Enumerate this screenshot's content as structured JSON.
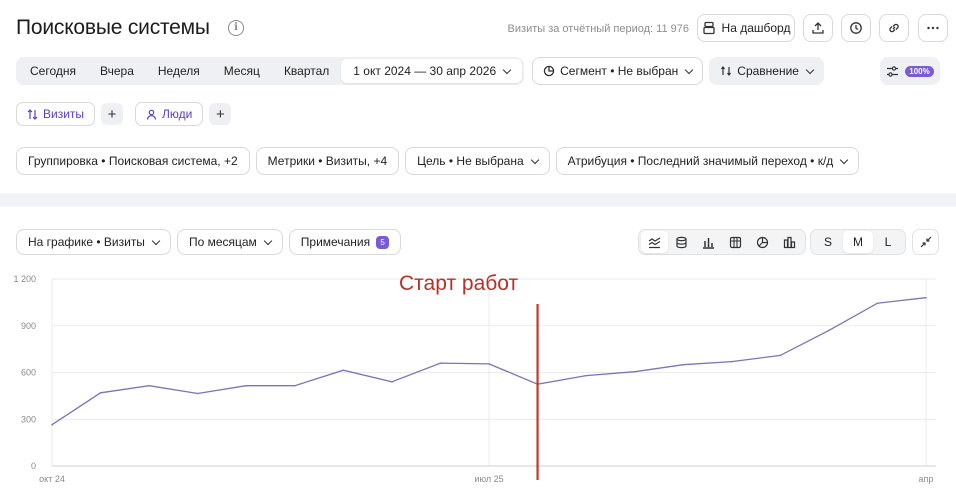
{
  "header": {
    "title": "Поисковые системы",
    "visits_total": "Визиты за отчётный период: 11 976",
    "dashboard_label": "На дашборд",
    "icons": [
      "info-icon",
      "dashboard-icon",
      "upload-icon",
      "clock-icon",
      "link-icon",
      "more-icon"
    ]
  },
  "periods": {
    "items": [
      "Сегодня",
      "Вчера",
      "Неделя",
      "Месяц",
      "Квартал"
    ],
    "range": "1 окт 2024 — 30 апр 2026"
  },
  "segment_label": "Сегмент • Не выбран",
  "compare_label": "Сравнение",
  "sampling_badge": "100%",
  "metric_chips": {
    "visits": "Визиты",
    "people": "Люди"
  },
  "options": {
    "grouping": "Группировка • Поисковая система, +2",
    "metrics": "Метрики • Визиты, +4",
    "goal": "Цель • Не выбрана",
    "attribution": "Атрибуция • Последний значимый переход • к/д"
  },
  "chart_toolbar": {
    "on_chart": "На графике • Визиты",
    "by_months": "По месяцам",
    "notes": "Примечания",
    "notes_count": "5",
    "sizes": [
      "S",
      "M",
      "L"
    ],
    "active_size": "M"
  },
  "annotation": {
    "text": "Старт работ",
    "color": "#b8302a"
  },
  "colors": {
    "series": "#7b74b5",
    "accent": "#7a5ad8",
    "annotation_line": "#c0392b"
  },
  "chart_data": {
    "type": "line",
    "y_ticks": [
      0,
      300,
      600,
      900,
      1200
    ],
    "y_tick_labels": [
      "0",
      "300",
      "600",
      "900",
      "1 200"
    ],
    "ylim": [
      0,
      1200
    ],
    "x_tick_labels": [
      {
        "index": 0,
        "label": "окт 24"
      },
      {
        "index": 9,
        "label": "июл 25"
      },
      {
        "index": 18,
        "label": "апр"
      }
    ],
    "x": [
      "окт 2024",
      "ноя 2024",
      "дек 2024",
      "янв 2025",
      "фев 2025",
      "мар 2025",
      "апр 2025",
      "май 2025",
      "июн 2025",
      "июл 2025",
      "авг 2025",
      "сен 2025",
      "окт 2025",
      "ноя 2025",
      "дек 2025",
      "янв 2026",
      "фев 2026",
      "мар 2026",
      "апр 2026"
    ],
    "series": [
      {
        "values": [
          265,
          470,
          515,
          465,
          515,
          515,
          615,
          540,
          660,
          655,
          525,
          580,
          605,
          650,
          670,
          710,
          870,
          1045,
          1080
        ]
      }
    ],
    "marker_index": 10,
    "grid": true,
    "legend": "none"
  }
}
